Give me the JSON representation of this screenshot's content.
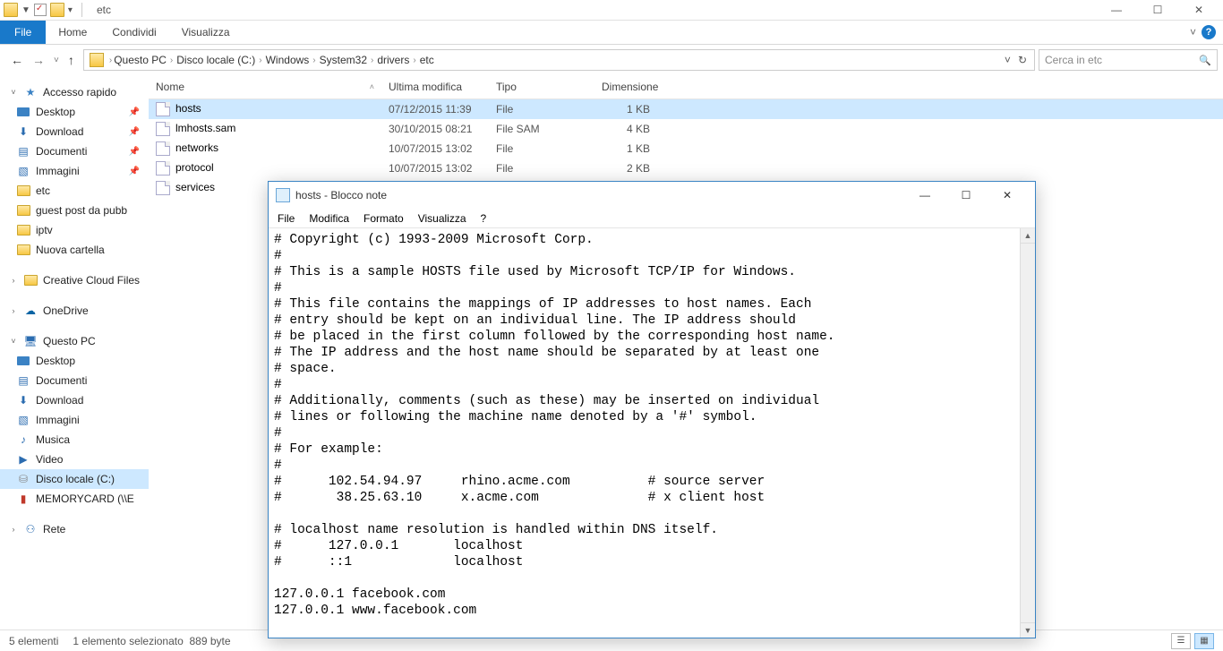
{
  "titlebar": {
    "title": "etc"
  },
  "win_controls": {
    "min": "—",
    "max": "☐",
    "close": "✕"
  },
  "ribbon": {
    "file": "File",
    "tabs": [
      "Home",
      "Condividi",
      "Visualizza"
    ]
  },
  "nav": {
    "back": "←",
    "fwd": "→",
    "drop": "˅",
    "up": "↑"
  },
  "breadcrumb": [
    "Questo PC",
    "Disco locale (C:)",
    "Windows",
    "System32",
    "drivers",
    "etc"
  ],
  "addressbar": {
    "refresh": "↻",
    "drop": "˅"
  },
  "search": {
    "placeholder": "Cerca in etc",
    "icon": "🔍"
  },
  "sidebar": {
    "quick": {
      "label": "Accesso rapido",
      "items": [
        {
          "label": "Desktop",
          "pin": "📌",
          "ic": "desk"
        },
        {
          "label": "Download",
          "pin": "📌",
          "ic": "dl"
        },
        {
          "label": "Documenti",
          "pin": "📌",
          "ic": "doc"
        },
        {
          "label": "Immagini",
          "pin": "📌",
          "ic": "img"
        },
        {
          "label": "etc",
          "pin": "",
          "ic": "folder"
        },
        {
          "label": "guest post da pubb",
          "pin": "",
          "ic": "folder"
        },
        {
          "label": "iptv",
          "pin": "",
          "ic": "folder"
        },
        {
          "label": "Nuova cartella",
          "pin": "",
          "ic": "folder"
        }
      ]
    },
    "cc": "Creative Cloud Files",
    "onedrive": "OneDrive",
    "thispc": {
      "label": "Questo PC",
      "items": [
        {
          "label": "Desktop",
          "ic": "desk"
        },
        {
          "label": "Documenti",
          "ic": "doc"
        },
        {
          "label": "Download",
          "ic": "dl"
        },
        {
          "label": "Immagini",
          "ic": "img"
        },
        {
          "label": "Musica",
          "ic": "music"
        },
        {
          "label": "Video",
          "ic": "video"
        },
        {
          "label": "Disco locale (C:)",
          "ic": "drive",
          "sel": true
        },
        {
          "label": "MEMORYCARD (\\\\E",
          "ic": "sd"
        }
      ]
    },
    "network": "Rete"
  },
  "columns": {
    "name": "Nome",
    "date": "Ultima modifica",
    "type": "Tipo",
    "size": "Dimensione"
  },
  "files": [
    {
      "name": "hosts",
      "date": "07/12/2015 11:39",
      "type": "File",
      "size": "1 KB",
      "sel": true
    },
    {
      "name": "lmhosts.sam",
      "date": "30/10/2015 08:21",
      "type": "File SAM",
      "size": "4 KB"
    },
    {
      "name": "networks",
      "date": "10/07/2015 13:02",
      "type": "File",
      "size": "1 KB"
    },
    {
      "name": "protocol",
      "date": "10/07/2015 13:02",
      "type": "File",
      "size": "2 KB"
    },
    {
      "name": "services",
      "date": "",
      "type": "",
      "size": ""
    }
  ],
  "statusbar": {
    "count": "5 elementi",
    "sel": "1 elemento selezionato",
    "bytes": "889 byte"
  },
  "notepad": {
    "title": "hosts - Blocco note",
    "menu": [
      "File",
      "Modifica",
      "Formato",
      "Visualizza",
      "?"
    ],
    "content": "# Copyright (c) 1993-2009 Microsoft Corp.\n#\n# This is a sample HOSTS file used by Microsoft TCP/IP for Windows.\n#\n# This file contains the mappings of IP addresses to host names. Each\n# entry should be kept on an individual line. The IP address should\n# be placed in the first column followed by the corresponding host name.\n# The IP address and the host name should be separated by at least one\n# space.\n#\n# Additionally, comments (such as these) may be inserted on individual\n# lines or following the machine name denoted by a '#' symbol.\n#\n# For example:\n#\n#      102.54.94.97     rhino.acme.com          # source server\n#       38.25.63.10     x.acme.com              # x client host\n\n# localhost name resolution is handled within DNS itself.\n#      127.0.0.1       localhost\n#      ::1             localhost\n\n127.0.0.1 facebook.com\n127.0.0.1 www.facebook.com"
  }
}
